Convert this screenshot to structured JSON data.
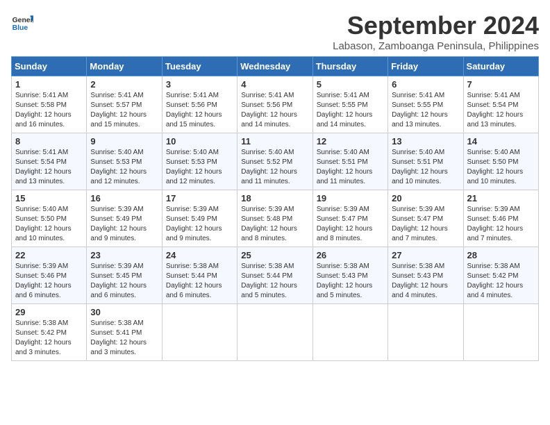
{
  "logo": {
    "line1": "General",
    "line2": "Blue"
  },
  "title": "September 2024",
  "location": "Labason, Zamboanga Peninsula, Philippines",
  "headers": [
    "Sunday",
    "Monday",
    "Tuesday",
    "Wednesday",
    "Thursday",
    "Friday",
    "Saturday"
  ],
  "weeks": [
    [
      {
        "day": "1",
        "sunrise": "5:41 AM",
        "sunset": "5:58 PM",
        "daylight": "12 hours and 16 minutes."
      },
      {
        "day": "2",
        "sunrise": "5:41 AM",
        "sunset": "5:57 PM",
        "daylight": "12 hours and 15 minutes."
      },
      {
        "day": "3",
        "sunrise": "5:41 AM",
        "sunset": "5:56 PM",
        "daylight": "12 hours and 15 minutes."
      },
      {
        "day": "4",
        "sunrise": "5:41 AM",
        "sunset": "5:56 PM",
        "daylight": "12 hours and 14 minutes."
      },
      {
        "day": "5",
        "sunrise": "5:41 AM",
        "sunset": "5:55 PM",
        "daylight": "12 hours and 14 minutes."
      },
      {
        "day": "6",
        "sunrise": "5:41 AM",
        "sunset": "5:55 PM",
        "daylight": "12 hours and 13 minutes."
      },
      {
        "day": "7",
        "sunrise": "5:41 AM",
        "sunset": "5:54 PM",
        "daylight": "12 hours and 13 minutes."
      }
    ],
    [
      {
        "day": "8",
        "sunrise": "5:41 AM",
        "sunset": "5:54 PM",
        "daylight": "12 hours and 13 minutes."
      },
      {
        "day": "9",
        "sunrise": "5:40 AM",
        "sunset": "5:53 PM",
        "daylight": "12 hours and 12 minutes."
      },
      {
        "day": "10",
        "sunrise": "5:40 AM",
        "sunset": "5:53 PM",
        "daylight": "12 hours and 12 minutes."
      },
      {
        "day": "11",
        "sunrise": "5:40 AM",
        "sunset": "5:52 PM",
        "daylight": "12 hours and 11 minutes."
      },
      {
        "day": "12",
        "sunrise": "5:40 AM",
        "sunset": "5:51 PM",
        "daylight": "12 hours and 11 minutes."
      },
      {
        "day": "13",
        "sunrise": "5:40 AM",
        "sunset": "5:51 PM",
        "daylight": "12 hours and 10 minutes."
      },
      {
        "day": "14",
        "sunrise": "5:40 AM",
        "sunset": "5:50 PM",
        "daylight": "12 hours and 10 minutes."
      }
    ],
    [
      {
        "day": "15",
        "sunrise": "5:40 AM",
        "sunset": "5:50 PM",
        "daylight": "12 hours and 10 minutes."
      },
      {
        "day": "16",
        "sunrise": "5:39 AM",
        "sunset": "5:49 PM",
        "daylight": "12 hours and 9 minutes."
      },
      {
        "day": "17",
        "sunrise": "5:39 AM",
        "sunset": "5:49 PM",
        "daylight": "12 hours and 9 minutes."
      },
      {
        "day": "18",
        "sunrise": "5:39 AM",
        "sunset": "5:48 PM",
        "daylight": "12 hours and 8 minutes."
      },
      {
        "day": "19",
        "sunrise": "5:39 AM",
        "sunset": "5:47 PM",
        "daylight": "12 hours and 8 minutes."
      },
      {
        "day": "20",
        "sunrise": "5:39 AM",
        "sunset": "5:47 PM",
        "daylight": "12 hours and 7 minutes."
      },
      {
        "day": "21",
        "sunrise": "5:39 AM",
        "sunset": "5:46 PM",
        "daylight": "12 hours and 7 minutes."
      }
    ],
    [
      {
        "day": "22",
        "sunrise": "5:39 AM",
        "sunset": "5:46 PM",
        "daylight": "12 hours and 6 minutes."
      },
      {
        "day": "23",
        "sunrise": "5:39 AM",
        "sunset": "5:45 PM",
        "daylight": "12 hours and 6 minutes."
      },
      {
        "day": "24",
        "sunrise": "5:38 AM",
        "sunset": "5:44 PM",
        "daylight": "12 hours and 6 minutes."
      },
      {
        "day": "25",
        "sunrise": "5:38 AM",
        "sunset": "5:44 PM",
        "daylight": "12 hours and 5 minutes."
      },
      {
        "day": "26",
        "sunrise": "5:38 AM",
        "sunset": "5:43 PM",
        "daylight": "12 hours and 5 minutes."
      },
      {
        "day": "27",
        "sunrise": "5:38 AM",
        "sunset": "5:43 PM",
        "daylight": "12 hours and 4 minutes."
      },
      {
        "day": "28",
        "sunrise": "5:38 AM",
        "sunset": "5:42 PM",
        "daylight": "12 hours and 4 minutes."
      }
    ],
    [
      {
        "day": "29",
        "sunrise": "5:38 AM",
        "sunset": "5:42 PM",
        "daylight": "12 hours and 3 minutes."
      },
      {
        "day": "30",
        "sunrise": "5:38 AM",
        "sunset": "5:41 PM",
        "daylight": "12 hours and 3 minutes."
      },
      null,
      null,
      null,
      null,
      null
    ]
  ]
}
